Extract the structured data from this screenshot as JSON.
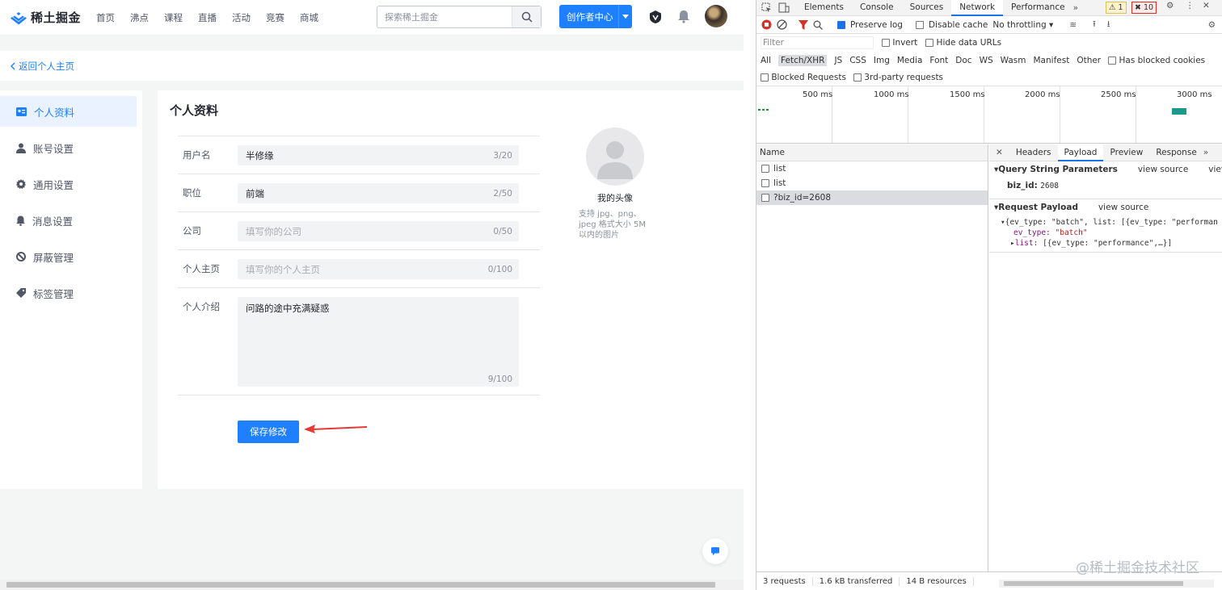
{
  "site": {
    "logo_text": "稀土掘金",
    "nav": [
      "首页",
      "沸点",
      "课程",
      "直播",
      "活动",
      "竞赛",
      "商城"
    ],
    "search_placeholder": "探索稀土掘金",
    "creator_button": "创作者中心"
  },
  "back_link": "返回个人主页",
  "sidebar": {
    "items": [
      {
        "label": "个人资料",
        "icon": "id-card-icon",
        "active": true
      },
      {
        "label": "账号设置",
        "icon": "user-icon"
      },
      {
        "label": "通用设置",
        "icon": "gear-icon"
      },
      {
        "label": "消息设置",
        "icon": "bell-icon"
      },
      {
        "label": "屏蔽管理",
        "icon": "block-icon"
      },
      {
        "label": "标签管理",
        "icon": "tag-icon"
      }
    ]
  },
  "profile": {
    "title": "个人资料",
    "fields": [
      {
        "label": "用户名",
        "value": "半修缘",
        "placeholder": "",
        "count": "3/20"
      },
      {
        "label": "职位",
        "value": "前端",
        "placeholder": "",
        "count": "2/50"
      },
      {
        "label": "公司",
        "value": "",
        "placeholder": "填写你的公司",
        "count": "0/50"
      },
      {
        "label": "个人主页",
        "value": "",
        "placeholder": "填写你的个人主页",
        "count": "0/100"
      }
    ],
    "bio": {
      "label": "个人介绍",
      "value": "问路的途中充满疑惑",
      "count": "9/100"
    },
    "save_button": "保存修改",
    "avatar_caption": "我的头像",
    "avatar_hint": "支持 jpg、png、jpeg 格式大小 5M以内的图片"
  },
  "devtools": {
    "tabs": [
      "Elements",
      "Console",
      "Sources",
      "Network",
      "Performance"
    ],
    "active_tab": "Network",
    "warnings": "1",
    "errors": "10",
    "toolbar": {
      "preserve_log": "Preserve log",
      "disable_cache": "Disable cache",
      "throttling": "No throttling"
    },
    "filter": {
      "placeholder": "Filter",
      "invert": "Invert",
      "hide_data_urls": "Hide data URLs"
    },
    "types": [
      "All",
      "Fetch/XHR",
      "JS",
      "CSS",
      "Img",
      "Media",
      "Font",
      "Doc",
      "WS",
      "Wasm",
      "Manifest",
      "Other"
    ],
    "active_type": "Fetch/XHR",
    "has_blocked_cookies": "Has blocked cookies",
    "blocked_requests": "Blocked Requests",
    "third_party": "3rd-party requests",
    "timeline_labels": [
      "500 ms",
      "1000 ms",
      "1500 ms",
      "2000 ms",
      "2500 ms",
      "3000 ms"
    ],
    "name_header": "Name",
    "requests": [
      "list",
      "list",
      "?biz_id=2608"
    ],
    "detail_tabs": [
      "Headers",
      "Payload",
      "Preview",
      "Response"
    ],
    "active_detail_tab": "Payload",
    "query_section": "Query String Parameters",
    "view_source": "view source",
    "view_decoded": "view deco",
    "biz_id_key": "biz_id:",
    "biz_id_val": "2608",
    "payload_section": "Request Payload",
    "payload_line1": "{ev_type: \"batch\", list: [{ev_type: \"performan",
    "payload_ev_key": "ev_type:",
    "payload_ev_val": "\"batch\"",
    "payload_list_key": "list:",
    "payload_list_val": "[{ev_type: \"performance\",…}]",
    "status": {
      "requests": "3 requests",
      "transferred": "1.6 kB transferred",
      "resources": "14 B resources"
    }
  },
  "watermark": "@稀土掘金技术社区"
}
